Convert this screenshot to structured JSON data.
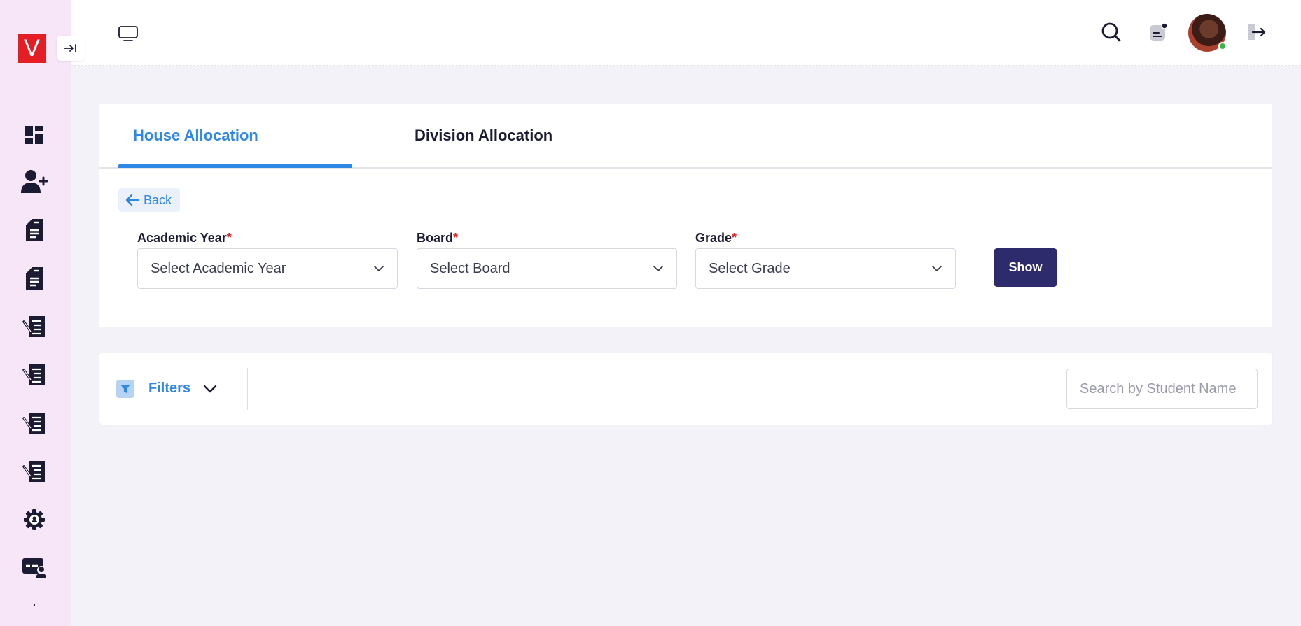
{
  "sidebar": {
    "logo_text": "V",
    "items": [
      {
        "name": "dashboard-icon"
      },
      {
        "name": "add-user-icon"
      },
      {
        "name": "document-icon"
      },
      {
        "name": "document-icon"
      },
      {
        "name": "edit-document-icon"
      },
      {
        "name": "edit-document-icon"
      },
      {
        "name": "edit-document-icon"
      },
      {
        "name": "edit-document-icon"
      },
      {
        "name": "settings-gear-icon"
      },
      {
        "name": "id-card-icon"
      }
    ]
  },
  "tabs": [
    {
      "label": "House Allocation",
      "active": true
    },
    {
      "label": "Division Allocation",
      "active": false
    }
  ],
  "back_label": "Back",
  "form": {
    "academic_year": {
      "label": "Academic Year",
      "required_mark": "*",
      "value": "Select Academic Year"
    },
    "board": {
      "label": "Board",
      "required_mark": "*",
      "value": "Select Board"
    },
    "grade": {
      "label": "Grade",
      "required_mark": "*",
      "value": "Select Grade"
    },
    "show_label": "Show"
  },
  "filters": {
    "label": "Filters",
    "search_placeholder": "Search by Student Name"
  },
  "colors": {
    "accent": "#2f87e6",
    "primary_button": "#2d2b6b",
    "sidebar_bg": "#f6e6f7",
    "logo": "#e31e24",
    "online_status": "#3bb54a"
  }
}
